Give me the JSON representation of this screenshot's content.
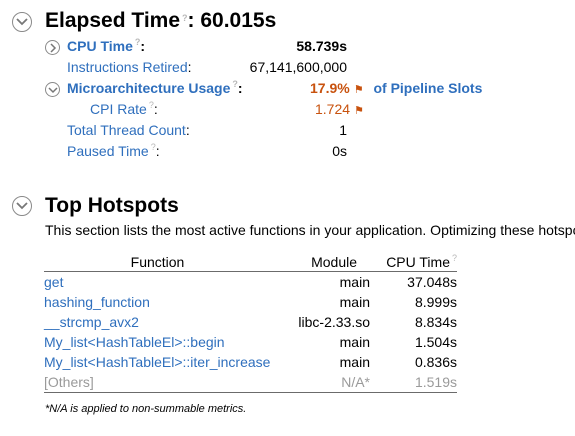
{
  "elapsed": {
    "label": "Elapsed Time",
    "help": "?",
    "sep": ":",
    "value": "60.015s"
  },
  "metrics": {
    "cpu_time": {
      "label": "CPU Time",
      "help": "?",
      "colon": ":",
      "value": "58.739s"
    },
    "instructions_retired": {
      "label": "Instructions Retired",
      "colon": ":",
      "value": "67,141,600,000"
    },
    "microarch": {
      "label": "Microarchitecture Usage",
      "help": "?",
      "colon": ":",
      "value": "17.9%",
      "flag": "⚑",
      "suffix": "of Pipeline Slots"
    },
    "cpi_rate": {
      "label": "CPI Rate",
      "help": "?",
      "colon": ":",
      "value": "1.724",
      "flag": "⚑"
    },
    "total_thread_count": {
      "label": "Total Thread Count",
      "colon": ":",
      "value": "1"
    },
    "paused_time": {
      "label": "Paused Time",
      "help": "?",
      "colon": ":",
      "value": "0s"
    }
  },
  "hotspots": {
    "title": "Top Hotspots",
    "description": "This section lists the most active functions in your application. Optimizing these hotspo",
    "columns": {
      "function": "Function",
      "module": "Module",
      "cpu_time": "CPU Time",
      "cpu_time_help": "?"
    },
    "rows": [
      {
        "function": "get",
        "module": "main",
        "cpu_time": "37.048s"
      },
      {
        "function": "hashing_function",
        "module": "main",
        "cpu_time": "8.999s"
      },
      {
        "function": "__strcmp_avx2",
        "module": "libc-2.33.so",
        "cpu_time": "8.834s"
      },
      {
        "function": "My_list<HashTableEl>::begin",
        "module": "main",
        "cpu_time": "1.504s"
      },
      {
        "function": "My_list<HashTableEl>::iter_increase",
        "module": "main",
        "cpu_time": "0.836s"
      },
      {
        "function": "[Others]",
        "module": "N/A*",
        "cpu_time": "1.519s"
      }
    ],
    "note": "*N/A is applied to non-summable metrics."
  },
  "colors": {
    "link": "#2f6fbd",
    "hotspot_flag": "#c8520e",
    "muted": "#9a9a9a"
  },
  "icons": {
    "collapse": "chevron-down-icon",
    "expand": "chevron-right-icon"
  }
}
